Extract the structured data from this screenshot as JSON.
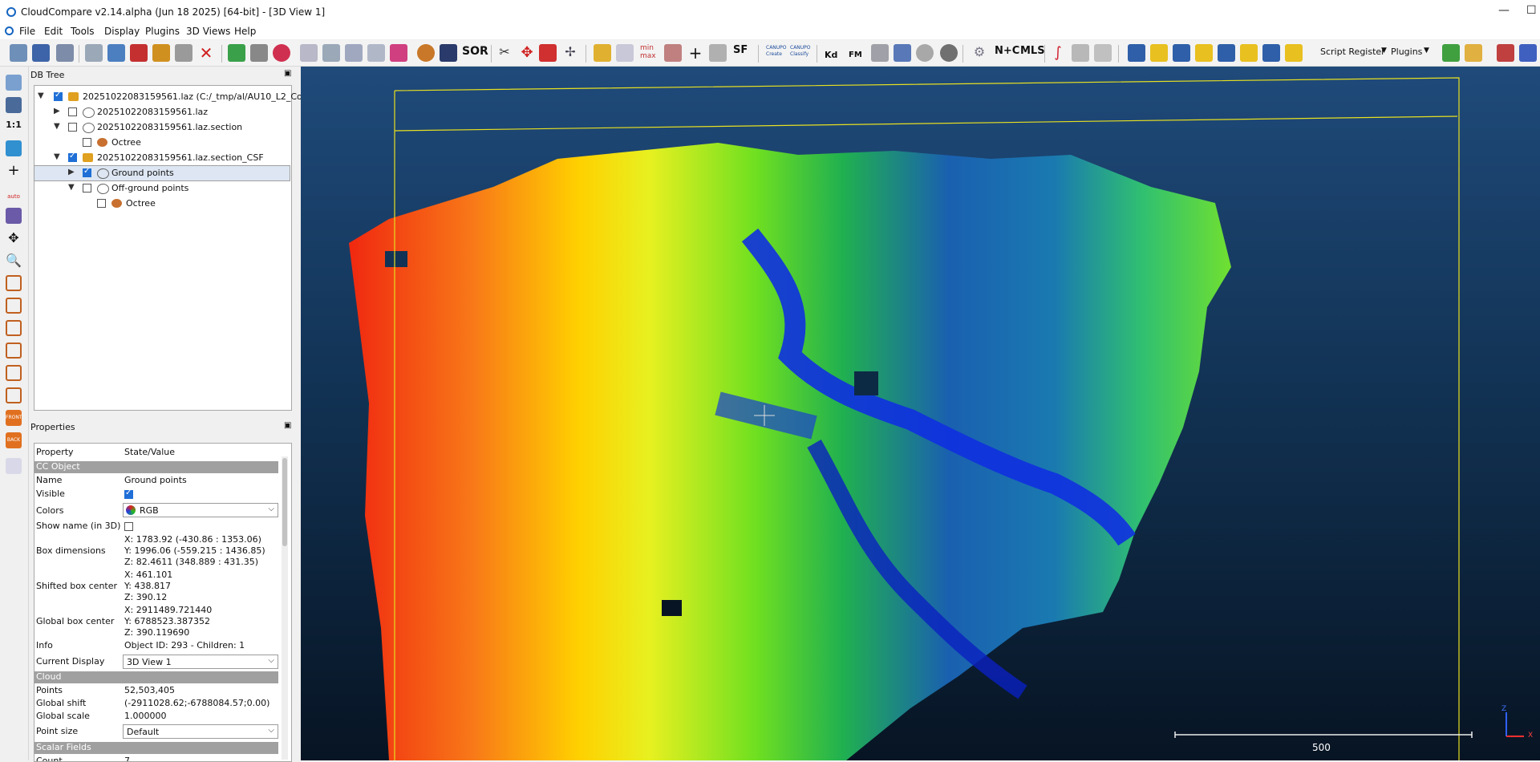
{
  "window": {
    "title": "CloudCompare v2.14.alpha (Jun 18 2025) [64-bit] - [3D View 1]",
    "minimize": "—",
    "maximize": "☐"
  },
  "menu": [
    "File",
    "Edit",
    "Tools",
    "Display",
    "Plugins",
    "3D Views",
    "Help"
  ],
  "toolbar": {
    "sor_label": "SOR",
    "sf_label": "SF",
    "minmax_label": "min max",
    "canupo_create": "CANUPO Create",
    "canupo_classify": "CANUPO Classify",
    "kd_label": "Kd",
    "fm_label": "FM",
    "nc_label": "N+C",
    "mls_label": "MLS",
    "script_register": "Script Register",
    "plugins": "Plugins",
    "one_to_one": "1:1",
    "auto_label": "auto",
    "front_label": "FRONT",
    "back_label": "BACK"
  },
  "db_tree": {
    "title": "DB Tree",
    "items": [
      {
        "label": "20251022083159561.laz (C:/_tmp/al/AU10_L2_Co..."
      },
      {
        "label": "20251022083159561.laz"
      },
      {
        "label": "20251022083159561.laz.section"
      },
      {
        "label": "Octree"
      },
      {
        "label": "20251022083159561.laz.section_CSF"
      },
      {
        "label": "Ground points"
      },
      {
        "label": "Off-ground points"
      },
      {
        "label": "Octree"
      }
    ]
  },
  "properties": {
    "title": "Properties",
    "header_property": "Property",
    "header_value": "State/Value",
    "sections": {
      "cc_object": "CC Object",
      "cloud": "Cloud",
      "scalar_fields": "Scalar Fields"
    },
    "name_label": "Name",
    "name_value": "Ground points",
    "visible_label": "Visible",
    "colors_label": "Colors",
    "colors_value": "RGB",
    "show_name_label": "Show name (in 3D)",
    "box_dim_label": "Box dimensions",
    "box_dim_x": "X: 1783.92 (-430.86 : 1353.06)",
    "box_dim_y": "Y: 1996.06 (-559.215 : 1436.85)",
    "box_dim_z": "Z: 82.4611 (348.889 : 431.35)",
    "shifted_center_label": "Shifted box center",
    "shifted_x": "X: 461.101",
    "shifted_y": "Y: 438.817",
    "shifted_z": "Z: 390.12",
    "global_center_label": "Global box center",
    "global_x": "X: 2911489.721440",
    "global_y": "Y: 6788523.387352",
    "global_z": "Z: 390.119690",
    "info_label": "Info",
    "info_value": "Object ID: 293 - Children: 1",
    "current_display_label": "Current Display",
    "current_display_value": "3D View 1",
    "points_label": "Points",
    "points_value": "52,503,405",
    "global_shift_label": "Global shift",
    "global_shift_value": "(-2911028.62;-6788084.57;0.00)",
    "global_scale_label": "Global scale",
    "global_scale_value": "1.000000",
    "point_size_label": "Point size",
    "point_size_value": "Default",
    "count_label": "Count",
    "count_value": "7"
  },
  "view3d": {
    "scale_label": "500",
    "axis_z": "Z",
    "axis_x": "X"
  }
}
